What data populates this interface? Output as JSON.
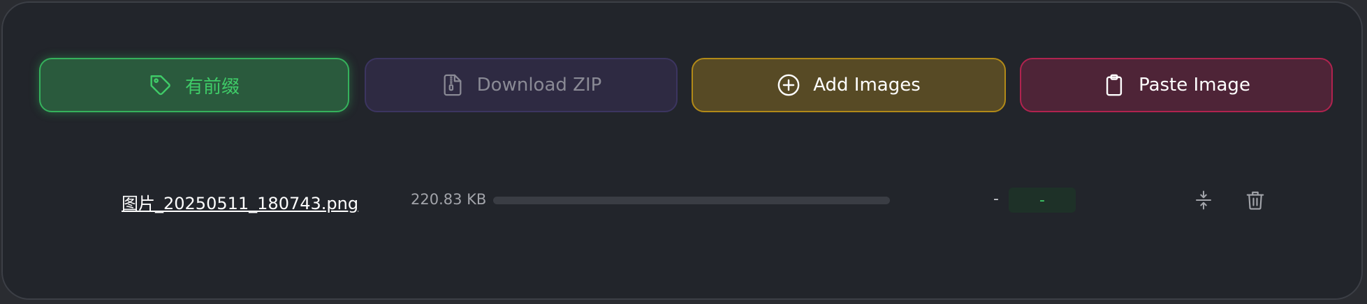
{
  "toolbar": {
    "prefix_label": "有前缀",
    "download_label": "Download ZIP",
    "add_label": "Add Images",
    "paste_label": "Paste Image"
  },
  "icons": {
    "prefix": "tag-icon",
    "download": "zip-file-icon",
    "add": "plus-circle-icon",
    "paste": "clipboard-icon",
    "compress": "compress-arrows-icon",
    "delete": "trash-icon"
  },
  "files": [
    {
      "name": "图片_20250511_180743.png",
      "size": "220.83 KB",
      "progress": 0,
      "compressed_size": "-",
      "ratio": "-"
    }
  ],
  "colors": {
    "prefix_accent": "#35b25c",
    "download_accent": "#3c3560",
    "add_accent": "#b28a18",
    "paste_accent": "#b1234f",
    "panel_bg": "#22252b"
  }
}
